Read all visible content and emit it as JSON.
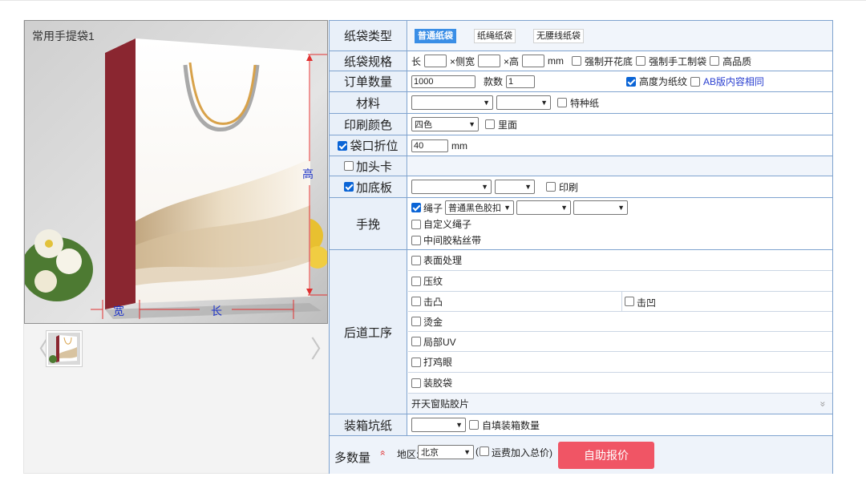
{
  "preview": {
    "title": "常用手提袋1",
    "dim_height": "高",
    "dim_width": "宽",
    "dim_length": "长",
    "prev_arrow": "〈",
    "next_arrow": "〉"
  },
  "form": {
    "bag_type": {
      "label": "纸袋类型",
      "options": [
        "普通纸袋",
        "纸绳纸袋",
        "无腰线纸袋"
      ],
      "selected": "普通纸袋"
    },
    "spec": {
      "label": "纸袋规格",
      "length": "长",
      "side": "×侧宽",
      "height": "×高",
      "unit": "mm",
      "opt1": "强制开花底",
      "opt2": "强制手工制袋",
      "opt3": "高品质"
    },
    "order": {
      "label": "订单数量",
      "quantity": "1000",
      "styles_label": "款数",
      "styles": "1",
      "paper_height": "高度为纸纹",
      "ab_same": "AB版内容相同"
    },
    "material": {
      "label": "材料",
      "special": "特种纸"
    },
    "print_color": {
      "label": "印刷颜色",
      "value": "四色",
      "inside": "里面"
    },
    "fold": {
      "label": "袋口折位",
      "value": "40",
      "unit": "mm"
    },
    "header_card": {
      "label": "加头卡"
    },
    "base_board": {
      "label": "加底板",
      "print": "印刷"
    },
    "handle": {
      "label": "手挽",
      "rope": "绳子",
      "rope_type": "普通黑色胶扣",
      "custom": "自定义绳子",
      "tape": "中间胶粘丝带"
    },
    "post": {
      "label": "后道工序",
      "items": [
        "表面处理",
        "压纹",
        "击凸",
        "击凹",
        "烫金",
        "局部UV",
        "打鸡眼",
        "装胶袋"
      ],
      "window": "开天窗贴胶片",
      "expand": "»"
    },
    "box": {
      "label": "装箱坑纸",
      "self_fill": "自填装箱数量"
    },
    "footer": {
      "multi": "多数量",
      "multi_icon": "»",
      "region_label": "地区:",
      "region": "北京",
      "freight": "运费加入总价)",
      "freight_prefix": "(",
      "quote": "自助报价"
    }
  }
}
